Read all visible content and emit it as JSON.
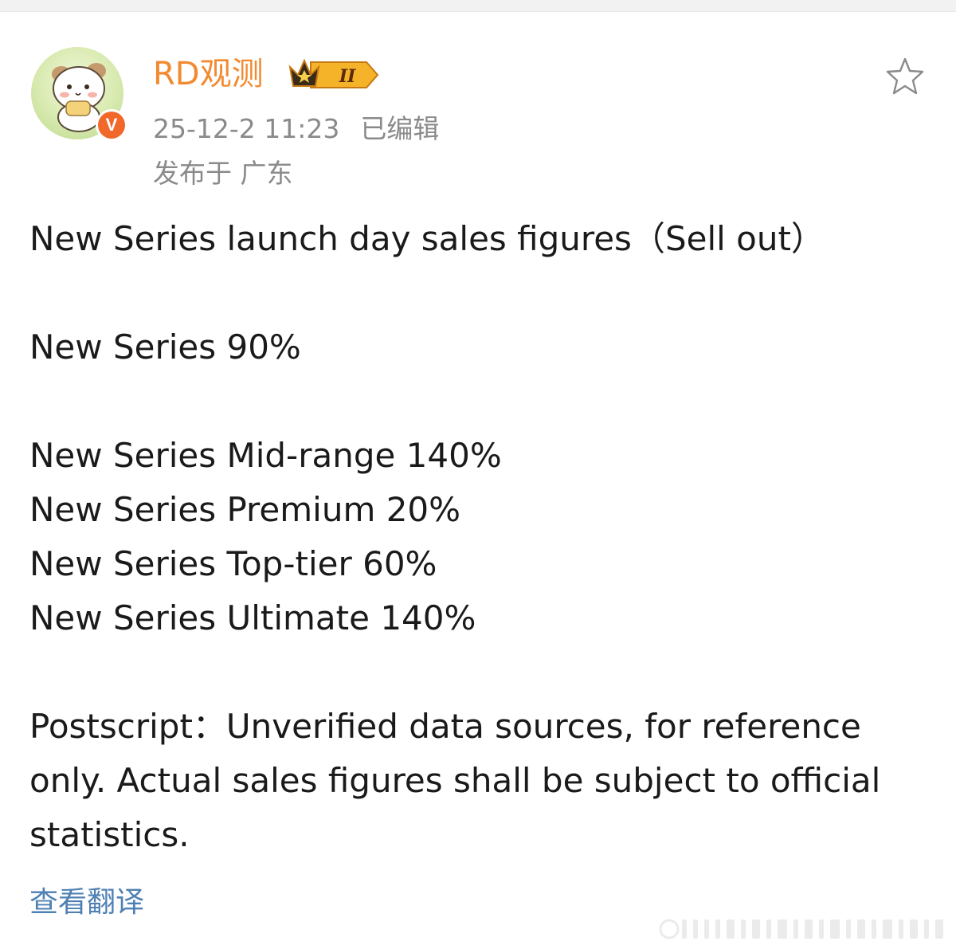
{
  "author": {
    "name": "RD观测",
    "verified_badge": "V",
    "level_badge": "II"
  },
  "meta": {
    "timestamp": "25-12-2 11:23",
    "edited_label": "已编辑",
    "location": "发布于 广东"
  },
  "post": {
    "title_line": "New Series launch day sales figures（Sell out）",
    "base_line": "New Series 90%",
    "tier_lines": [
      "New Series Mid-range 140%",
      "New Series Premium 20%",
      "New Series Top-tier 60%",
      "New Series Ultimate 140%"
    ],
    "postscript": "Postscript：Unverified data sources, for reference only. Actual sales figures shall be subject to official statistics."
  },
  "actions": {
    "translate_label": "查看翻译"
  },
  "icons": {
    "favorite": "star-outline-icon",
    "crown": "crown-icon"
  },
  "colors": {
    "username": "#f28a30",
    "meta": "#8a8a8a",
    "link": "#4f80b4",
    "verified": "#f2682a"
  }
}
